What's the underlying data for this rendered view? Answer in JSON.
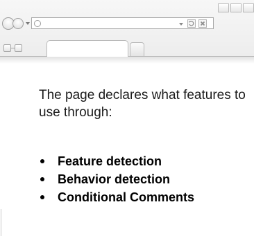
{
  "browser": {
    "address_value": "",
    "icons": {
      "back": "back-arrow-icon",
      "forward": "forward-arrow-icon",
      "refresh": "refresh-icon",
      "stop": "stop-icon"
    }
  },
  "content": {
    "intro": "The page declares what features to use through:",
    "bullets": [
      {
        "label": "Feature detection"
      },
      {
        "label": "Behavior detection"
      },
      {
        "label": "Conditional Comments"
      }
    ]
  }
}
